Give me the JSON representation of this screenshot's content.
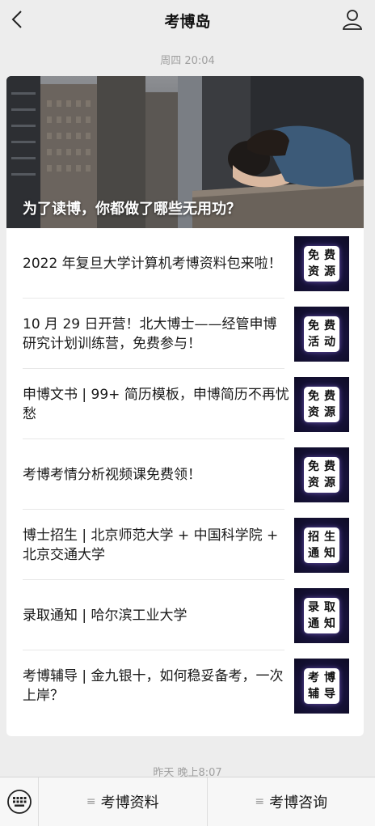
{
  "header": {
    "title": "考博岛",
    "back_icon": "chevron-left-icon",
    "profile_icon": "person-icon"
  },
  "timestamps": {
    "first": "周四 20:04",
    "second": "昨天 晚上8:07"
  },
  "cover": {
    "title": "为了读博，你都做了哪些无用功？"
  },
  "articles": [
    {
      "title": "2022 年复旦大学计算机考博资料包来啦！",
      "thumb": [
        "免",
        "费",
        "资",
        "源"
      ]
    },
    {
      "title": "10 月 29 日开营！北大博士——经管申博研究计划训练营，免费参与！",
      "thumb": [
        "免",
        "费",
        "活",
        "动"
      ]
    },
    {
      "title": "申博文书 | 99+ 简历模板，申博简历不再忧愁",
      "thumb": [
        "免",
        "费",
        "资",
        "源"
      ]
    },
    {
      "title": "考博考情分析视频课免费领！",
      "thumb": [
        "免",
        "费",
        "资",
        "源"
      ]
    },
    {
      "title": "博士招生 | 北京师范大学 + 中国科学院 + 北京交通大学",
      "thumb": [
        "招",
        "生",
        "通",
        "知"
      ]
    },
    {
      "title": "录取通知 | 哈尔滨工业大学",
      "thumb": [
        "录",
        "取",
        "通",
        "知"
      ]
    },
    {
      "title": "考博辅导 | 金九银十，如何稳妥备考，一次上岸？",
      "thumb": [
        "考",
        "博",
        "辅",
        "导"
      ]
    }
  ],
  "bottom_menu": {
    "keyboard_icon": "keyboard-icon",
    "menu_icon": "menu-lines-icon",
    "items": [
      "考博资料",
      "考博咨询"
    ]
  }
}
